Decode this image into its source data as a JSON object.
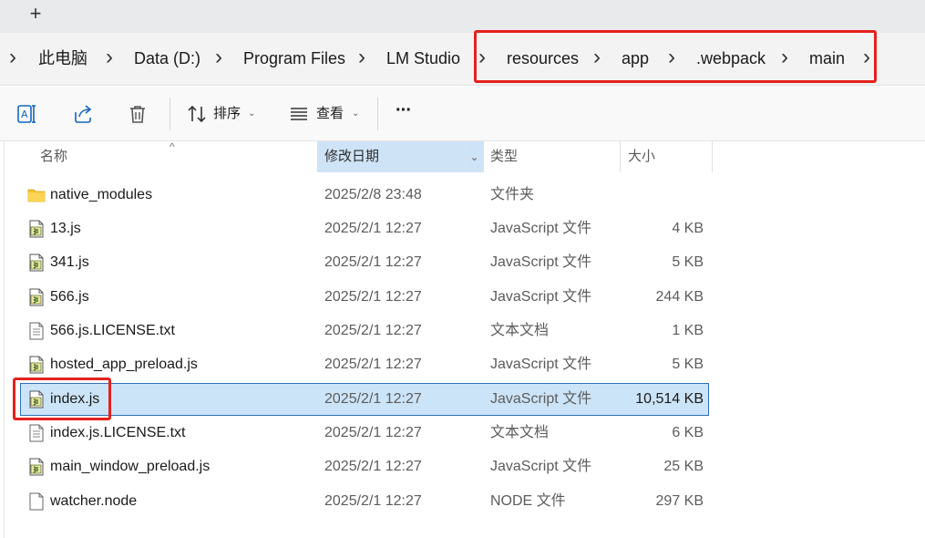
{
  "tabstrip": {
    "new_tab_label": "+"
  },
  "breadcrumb": [
    {
      "label": "此电脑"
    },
    {
      "label": "Data (D:)"
    },
    {
      "label": "Program Files"
    },
    {
      "label": "LM Studio"
    },
    {
      "label": "resources"
    },
    {
      "label": "app"
    },
    {
      "label": ".webpack"
    },
    {
      "label": "main"
    }
  ],
  "toolbar": {
    "sort_label": "排序",
    "view_label": "查看",
    "more_label": "···"
  },
  "columns": {
    "name": "名称",
    "date": "修改日期",
    "type": "类型",
    "size": "大小"
  },
  "files": [
    {
      "name": "native_modules",
      "date": "2025/2/8 23:48",
      "type": "文件夹",
      "size": "",
      "icon": "folder-icon"
    },
    {
      "name": "13.js",
      "date": "2025/2/1 12:27",
      "type": "JavaScript 文件",
      "size": "4 KB",
      "icon": "js-file-icon"
    },
    {
      "name": "341.js",
      "date": "2025/2/1 12:27",
      "type": "JavaScript 文件",
      "size": "5 KB",
      "icon": "js-file-icon"
    },
    {
      "name": "566.js",
      "date": "2025/2/1 12:27",
      "type": "JavaScript 文件",
      "size": "244 KB",
      "icon": "js-file-icon"
    },
    {
      "name": "566.js.LICENSE.txt",
      "date": "2025/2/1 12:27",
      "type": "文本文档",
      "size": "1 KB",
      "icon": "text-file-icon"
    },
    {
      "name": "hosted_app_preload.js",
      "date": "2025/2/1 12:27",
      "type": "JavaScript 文件",
      "size": "5 KB",
      "icon": "js-file-icon"
    },
    {
      "name": "index.js",
      "date": "2025/2/1 12:27",
      "type": "JavaScript 文件",
      "size": "10,514 KB",
      "icon": "js-file-icon",
      "selected": true
    },
    {
      "name": "index.js.LICENSE.txt",
      "date": "2025/2/1 12:27",
      "type": "文本文档",
      "size": "6 KB",
      "icon": "text-file-icon"
    },
    {
      "name": "main_window_preload.js",
      "date": "2025/2/1 12:27",
      "type": "JavaScript 文件",
      "size": "25 KB",
      "icon": "js-file-icon"
    },
    {
      "name": "watcher.node",
      "date": "2025/2/1 12:27",
      "type": "NODE 文件",
      "size": "297 KB",
      "icon": "blank-file-icon"
    }
  ],
  "colors": {
    "highlight": "#e5211d",
    "selection": "#cce4f7",
    "selection_border": "#2f6fb5",
    "sorted_column": "#cfe3f7"
  }
}
